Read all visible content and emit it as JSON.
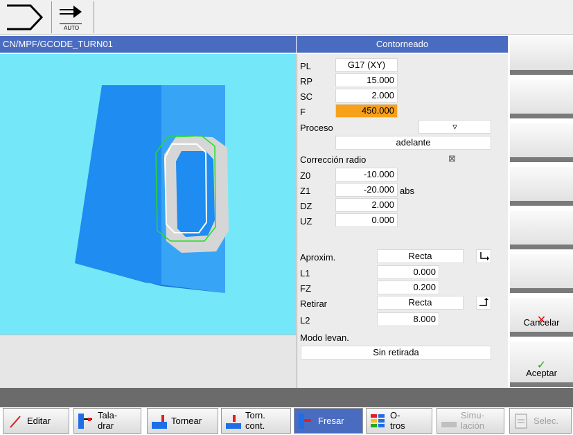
{
  "topbar": {
    "auto_label": "AUTO"
  },
  "title": {
    "path": "CN/MPF/GCODE_TURN01",
    "dialog": "Contorneado"
  },
  "params": {
    "pl": {
      "label": "PL",
      "value": "G17 (XY)"
    },
    "rp": {
      "label": "RP",
      "value": "15.000"
    },
    "sc": {
      "label": "SC",
      "value": "2.000"
    },
    "f": {
      "label": "F",
      "value": "450.000"
    },
    "proceso": {
      "label": "Proceso",
      "value": "▿"
    },
    "direction": {
      "value": "adelante"
    },
    "correccion": {
      "label": "Corrección radio",
      "value": "⊠"
    },
    "z0": {
      "label": "Z0",
      "value": "-10.000"
    },
    "z1": {
      "label": "Z1",
      "value": "-20.000",
      "unit": "abs"
    },
    "dz": {
      "label": "DZ",
      "value": "2.000"
    },
    "uz": {
      "label": "UZ",
      "value": "0.000"
    },
    "aproxim": {
      "label": "Aproxim.",
      "value": "Recta"
    },
    "l1": {
      "label": "L1",
      "value": "0.000"
    },
    "fz": {
      "label": "FZ",
      "value": "0.200"
    },
    "retirar": {
      "label": "Retirar",
      "value": "Recta"
    },
    "l2": {
      "label": "L2",
      "value": "8.000"
    },
    "modo": {
      "label": "Modo levan.",
      "value": "Sin retirada"
    }
  },
  "softkeys_right": {
    "cancel": "Cancelar",
    "accept": "Aceptar"
  },
  "softkeys_bottom": {
    "editar": "Editar",
    "taladrar1": "Tala-",
    "taladrar2": "drar",
    "tornear": "Tornear",
    "torn1": "Torn.",
    "torn2": "cont.",
    "fresar": "Fresar",
    "otros1": "O-",
    "otros2": "tros",
    "simu1": "Simu-",
    "simu2": "lación",
    "selec": "Selec."
  },
  "colors": {
    "accent": "#4a6cc0",
    "selected_field": "#f7a11a",
    "graphic_bg": "#74e8f8",
    "cube": "#1e8cf0"
  }
}
